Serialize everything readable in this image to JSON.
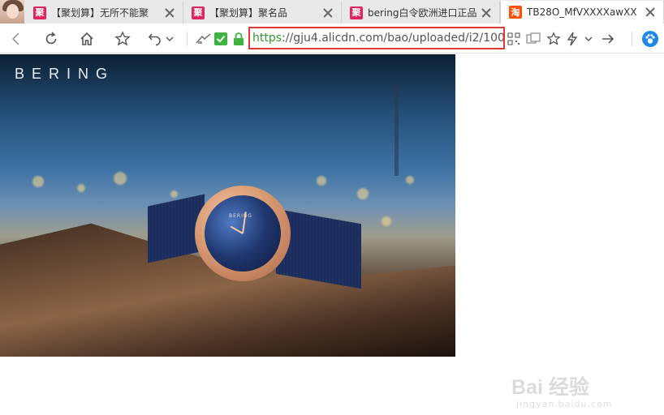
{
  "tabs": [
    {
      "favicon_text": "聚",
      "favicon_color": "#e0245e",
      "title": "【聚划算】无所不能聚"
    },
    {
      "favicon_text": "聚",
      "favicon_color": "#e0245e",
      "title": "【聚划算】聚名品"
    },
    {
      "favicon_text": "聚",
      "favicon_color": "#e0245e",
      "title": "bering白令欧洲进口正品"
    },
    {
      "favicon_text": "淘",
      "favicon_color": "#ff5000",
      "title": "TB28O_MfVXXXXawXX"
    }
  ],
  "address_bar": {
    "scheme": "https",
    "rest": "://gju4.alicdn.com/bao/uploaded/i2/100"
  },
  "content": {
    "brand_logo": "BERING",
    "dial_brand": "BERING"
  },
  "watermark": {
    "main": "Bai 经验",
    "sub": "jingyan.baidu.com"
  },
  "colors": {
    "url_highlight_border": "#e53935",
    "https_green": "#2e9a2e",
    "extension_blue": "#1e88e5"
  }
}
